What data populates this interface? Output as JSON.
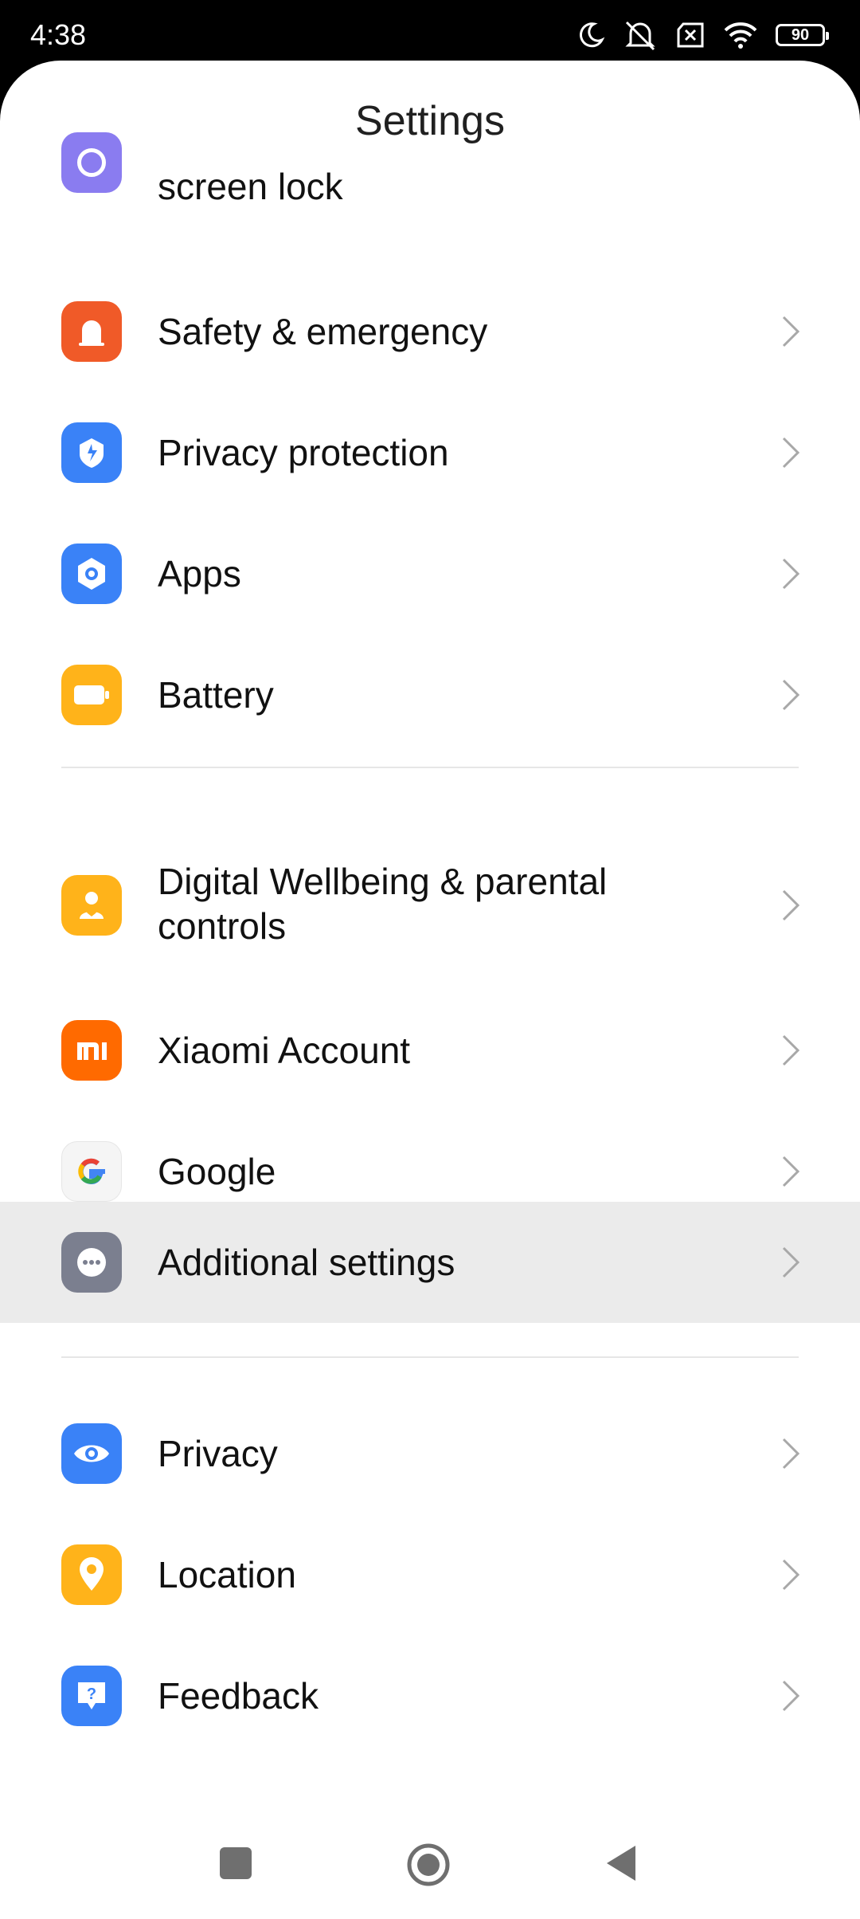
{
  "status": {
    "time": "4:38",
    "battery": "90"
  },
  "header": {
    "title": "Settings"
  },
  "items": [
    {
      "label": "screen lock",
      "icon": "lock-icon",
      "color": "#8a7cf0"
    },
    {
      "label": "Safety & emergency",
      "icon": "emergency-icon",
      "color": "#f05a28"
    },
    {
      "label": "Privacy protection",
      "icon": "privacy-protection-icon",
      "color": "#3a82f7"
    },
    {
      "label": "Apps",
      "icon": "apps-icon",
      "color": "#3a82f7"
    },
    {
      "label": "Battery",
      "icon": "battery-icon",
      "color": "#ffb31a"
    },
    {
      "label": "Digital Wellbeing & parental controls",
      "icon": "wellbeing-icon",
      "color": "#ffb31a"
    },
    {
      "label": "Xiaomi Account",
      "icon": "xiaomi-icon",
      "color": "#ff6a00"
    },
    {
      "label": "Google",
      "icon": "google-icon",
      "color": "#f5f5f5"
    },
    {
      "label": "Additional settings",
      "icon": "more-icon",
      "color": "#7b7f8f"
    },
    {
      "label": "Privacy",
      "icon": "eye-icon",
      "color": "#3a82f7"
    },
    {
      "label": "Location",
      "icon": "location-icon",
      "color": "#ffb31a"
    },
    {
      "label": "Feedback",
      "icon": "feedback-icon",
      "color": "#3a82f7"
    }
  ]
}
